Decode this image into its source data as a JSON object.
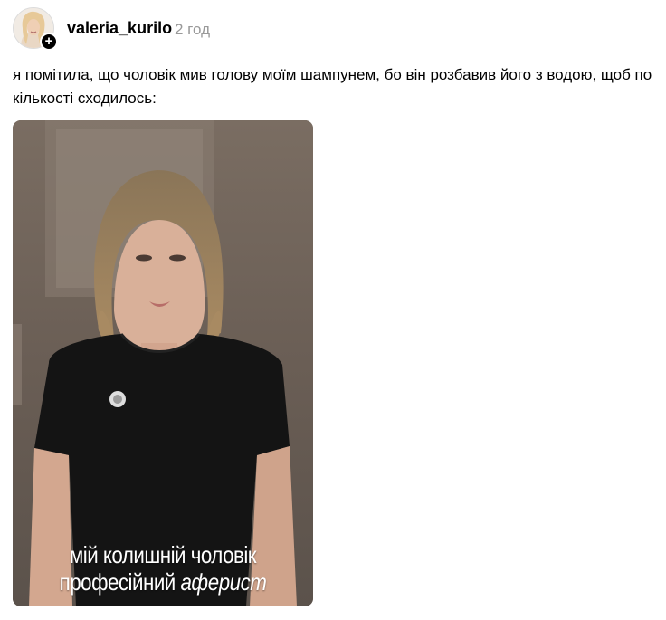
{
  "post": {
    "username": "valeria_kurilo",
    "timestamp": "2 год",
    "caption": "я помітила, що чоловік мив голову моїм шампунем, бо він розбавив його з водою, щоб по кількості сходилось:",
    "follow_icon": "plus-icon"
  },
  "video": {
    "overlay_line1": "мій колишній чоловік",
    "overlay_line2_plain": "професійний",
    "overlay_line2_italic": "аферист"
  },
  "colors": {
    "timestamp": "#999999",
    "media_background": "#6a5f56"
  }
}
